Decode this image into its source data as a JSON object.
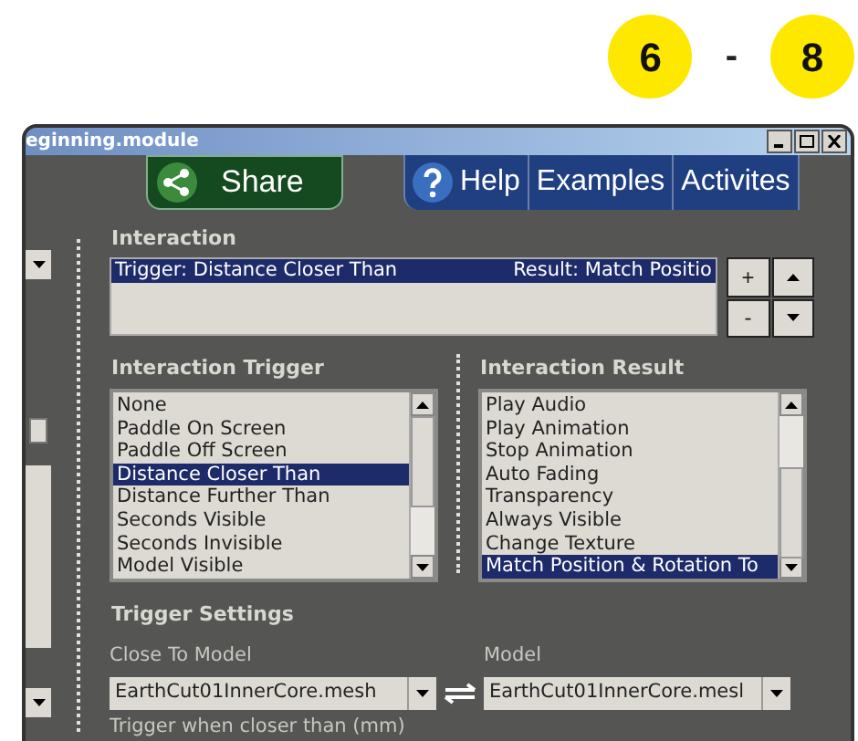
{
  "badges": [
    {
      "kind": "circle",
      "text": "6"
    },
    {
      "kind": "dash",
      "text": "-"
    },
    {
      "kind": "circle",
      "text": "8"
    }
  ],
  "window": {
    "title": "eginning.module"
  },
  "toolbar": {
    "share": "Share",
    "tabs": [
      {
        "label": "Help",
        "icon": true
      },
      {
        "label": "Examples",
        "icon": false
      },
      {
        "label": "Activites",
        "icon": false
      }
    ]
  },
  "interaction": {
    "label": "Interaction",
    "rows": [
      {
        "trigger": "Trigger: Distance Closer Than",
        "result": "Result: Match Positio",
        "selected": true
      }
    ],
    "buttons": [
      {
        "kind": "text",
        "label": "+"
      },
      {
        "kind": "up"
      },
      {
        "kind": "text",
        "label": "-"
      },
      {
        "kind": "down"
      }
    ]
  },
  "trigger_list": {
    "label": "Interaction Trigger",
    "items": [
      {
        "label": "None",
        "selected": false
      },
      {
        "label": "Paddle On Screen",
        "selected": false
      },
      {
        "label": "Paddle Off Screen",
        "selected": false
      },
      {
        "label": "Distance Closer Than",
        "selected": true
      },
      {
        "label": "Distance Further Than",
        "selected": false
      },
      {
        "label": "Seconds Visible",
        "selected": false
      },
      {
        "label": "Seconds Invisible",
        "selected": false
      },
      {
        "label": "Model Visible",
        "selected": false
      }
    ]
  },
  "result_list": {
    "label": "Interaction Result",
    "items": [
      {
        "label": "Play Audio",
        "selected": false
      },
      {
        "label": "Play Animation",
        "selected": false
      },
      {
        "label": "Stop Animation",
        "selected": false
      },
      {
        "label": "Auto Fading",
        "selected": false
      },
      {
        "label": "Transparency",
        "selected": false
      },
      {
        "label": "Always Visible",
        "selected": false
      },
      {
        "label": "Change Texture",
        "selected": false
      },
      {
        "label": "Match Position & Rotation To",
        "selected": true
      }
    ]
  },
  "trigger_settings": {
    "title": "Trigger Settings",
    "close_label": "Close To Model",
    "close_value": "EarthCut01InnerCore.mesh",
    "model_label": "Model",
    "model_value": "EarthCut01InnerCore.mesl",
    "hint": "Trigger when closer than (mm)"
  }
}
